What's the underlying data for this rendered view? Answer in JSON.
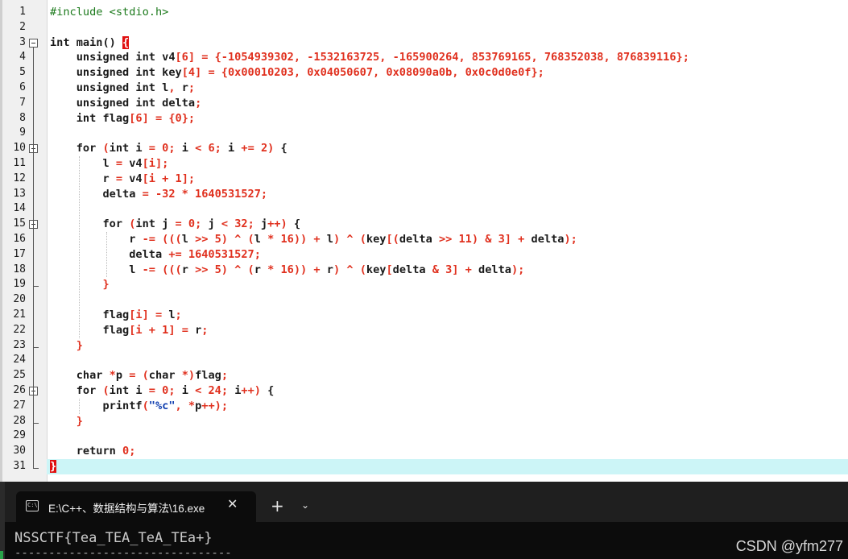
{
  "editor": {
    "lines": [
      {
        "n": "1",
        "segs": [
          [
            "pp",
            "#include <stdio.h>"
          ]
        ]
      },
      {
        "n": "2",
        "segs": []
      },
      {
        "n": "3",
        "segs": [
          [
            "kw",
            "int main() "
          ],
          [
            "cursor",
            "{"
          ]
        ]
      },
      {
        "n": "4",
        "segs": [
          [
            "kw",
            "    unsigned int v4"
          ],
          [
            "op",
            "[6]"
          ],
          [
            "kw",
            " "
          ],
          [
            "op",
            "="
          ],
          [
            "kw",
            " "
          ],
          [
            "op",
            "{-1054939302, -1532163725, -165900264, 853769165, 768352038, 876839116};"
          ]
        ]
      },
      {
        "n": "5",
        "segs": [
          [
            "kw",
            "    unsigned int key"
          ],
          [
            "op",
            "[4]"
          ],
          [
            "kw",
            " "
          ],
          [
            "op",
            "= {0x00010203, 0x04050607, 0x08090a0b, 0x0c0d0e0f};"
          ]
        ]
      },
      {
        "n": "6",
        "segs": [
          [
            "kw",
            "    unsigned int l"
          ],
          [
            "op",
            ","
          ],
          [
            "kw",
            " r"
          ],
          [
            "op",
            ";"
          ]
        ]
      },
      {
        "n": "7",
        "segs": [
          [
            "kw",
            "    unsigned int delta"
          ],
          [
            "op",
            ";"
          ]
        ]
      },
      {
        "n": "8",
        "segs": [
          [
            "kw",
            "    int flag"
          ],
          [
            "op",
            "[6] = {0};"
          ]
        ]
      },
      {
        "n": "9",
        "segs": []
      },
      {
        "n": "10",
        "segs": [
          [
            "kw",
            "    for "
          ],
          [
            "op",
            "("
          ],
          [
            "kw",
            "int i "
          ],
          [
            "op",
            "= 0;"
          ],
          [
            "kw",
            " i "
          ],
          [
            "op",
            "< 6;"
          ],
          [
            "kw",
            " i "
          ],
          [
            "op",
            "+= 2)"
          ],
          [
            "kw",
            " {"
          ]
        ]
      },
      {
        "n": "11",
        "segs": [
          [
            "kw",
            "        l "
          ],
          [
            "op",
            "="
          ],
          [
            "kw",
            " v4"
          ],
          [
            "op",
            "[i];"
          ]
        ]
      },
      {
        "n": "12",
        "segs": [
          [
            "kw",
            "        r "
          ],
          [
            "op",
            "="
          ],
          [
            "kw",
            " v4"
          ],
          [
            "op",
            "[i + 1];"
          ]
        ]
      },
      {
        "n": "13",
        "segs": [
          [
            "kw",
            "        delta "
          ],
          [
            "op",
            "= -32 * 1640531527;"
          ]
        ]
      },
      {
        "n": "14",
        "segs": []
      },
      {
        "n": "15",
        "segs": [
          [
            "kw",
            "        for "
          ],
          [
            "op",
            "("
          ],
          [
            "kw",
            "int j "
          ],
          [
            "op",
            "= 0;"
          ],
          [
            "kw",
            " j "
          ],
          [
            "op",
            "< 32;"
          ],
          [
            "kw",
            " j"
          ],
          [
            "op",
            "++)"
          ],
          [
            "kw",
            " {"
          ]
        ]
      },
      {
        "n": "16",
        "segs": [
          [
            "kw",
            "            r "
          ],
          [
            "op",
            "-= ((("
          ],
          [
            "kw",
            "l "
          ],
          [
            "op",
            ">> 5) ^ ("
          ],
          [
            "kw",
            "l "
          ],
          [
            "op",
            "* 16)) +"
          ],
          [
            "kw",
            " l"
          ],
          [
            "op",
            ") ^ ("
          ],
          [
            "kw",
            "key"
          ],
          [
            "op",
            "[("
          ],
          [
            "kw",
            "delta "
          ],
          [
            "op",
            ">> 11) & 3] +"
          ],
          [
            "kw",
            " delta"
          ],
          [
            "op",
            ");"
          ]
        ]
      },
      {
        "n": "17",
        "segs": [
          [
            "kw",
            "            delta "
          ],
          [
            "op",
            "+= 1640531527;"
          ]
        ]
      },
      {
        "n": "18",
        "segs": [
          [
            "kw",
            "            l "
          ],
          [
            "op",
            "-= ((("
          ],
          [
            "kw",
            "r "
          ],
          [
            "op",
            ">> 5) ^ ("
          ],
          [
            "kw",
            "r "
          ],
          [
            "op",
            "* 16)) +"
          ],
          [
            "kw",
            " r"
          ],
          [
            "op",
            ") ^ ("
          ],
          [
            "kw",
            "key"
          ],
          [
            "op",
            "["
          ],
          [
            "kw",
            "delta "
          ],
          [
            "op",
            "& 3] +"
          ],
          [
            "kw",
            " delta"
          ],
          [
            "op",
            ");"
          ]
        ]
      },
      {
        "n": "19",
        "segs": [
          [
            "kw",
            "        "
          ],
          [
            "op",
            "}"
          ]
        ]
      },
      {
        "n": "20",
        "segs": []
      },
      {
        "n": "21",
        "segs": [
          [
            "kw",
            "        flag"
          ],
          [
            "op",
            "[i] ="
          ],
          [
            "kw",
            " l"
          ],
          [
            "op",
            ";"
          ]
        ]
      },
      {
        "n": "22",
        "segs": [
          [
            "kw",
            "        flag"
          ],
          [
            "op",
            "[i + 1] ="
          ],
          [
            "kw",
            " r"
          ],
          [
            "op",
            ";"
          ]
        ]
      },
      {
        "n": "23",
        "segs": [
          [
            "kw",
            "    "
          ],
          [
            "op",
            "}"
          ]
        ]
      },
      {
        "n": "24",
        "segs": []
      },
      {
        "n": "25",
        "segs": [
          [
            "kw",
            "    char "
          ],
          [
            "op",
            "*"
          ],
          [
            "kw",
            "p "
          ],
          [
            "op",
            "= ("
          ],
          [
            "kw",
            "char "
          ],
          [
            "op",
            "*)"
          ],
          [
            "kw",
            "flag"
          ],
          [
            "op",
            ";"
          ]
        ]
      },
      {
        "n": "26",
        "segs": [
          [
            "kw",
            "    for "
          ],
          [
            "op",
            "("
          ],
          [
            "kw",
            "int i "
          ],
          [
            "op",
            "= 0;"
          ],
          [
            "kw",
            " i "
          ],
          [
            "op",
            "< 24;"
          ],
          [
            "kw",
            " i"
          ],
          [
            "op",
            "++)"
          ],
          [
            "kw",
            " {"
          ]
        ]
      },
      {
        "n": "27",
        "segs": [
          [
            "kw",
            "        printf"
          ],
          [
            "op",
            "("
          ],
          [
            "str",
            "\"%c\""
          ],
          [
            "op",
            ", *"
          ],
          [
            "kw",
            "p"
          ],
          [
            "op",
            "++);"
          ]
        ]
      },
      {
        "n": "28",
        "segs": [
          [
            "kw",
            "    "
          ],
          [
            "op",
            "}"
          ]
        ]
      },
      {
        "n": "29",
        "segs": []
      },
      {
        "n": "30",
        "segs": [
          [
            "kw",
            "    return "
          ],
          [
            "op",
            "0;"
          ]
        ]
      },
      {
        "n": "31",
        "segs": [
          [
            "cursor",
            "}"
          ]
        ]
      }
    ],
    "fold_starts": [
      "3",
      "10",
      "15",
      "26"
    ],
    "fold_ends": [
      "19",
      "23",
      "28",
      "31"
    ],
    "current_line": "31"
  },
  "terminal": {
    "tab_title": "E:\\C++、数据结构与算法\\16.exe",
    "tab_icon_text": "C:\\",
    "close_glyph": "✕",
    "plus_glyph": "+",
    "dropdown_glyph": "⌄",
    "output": "NSSCTF{Tea_TEA_TeA_TEa+}",
    "separator": "--------------------------------"
  },
  "watermark": "CSDN @yfm277"
}
